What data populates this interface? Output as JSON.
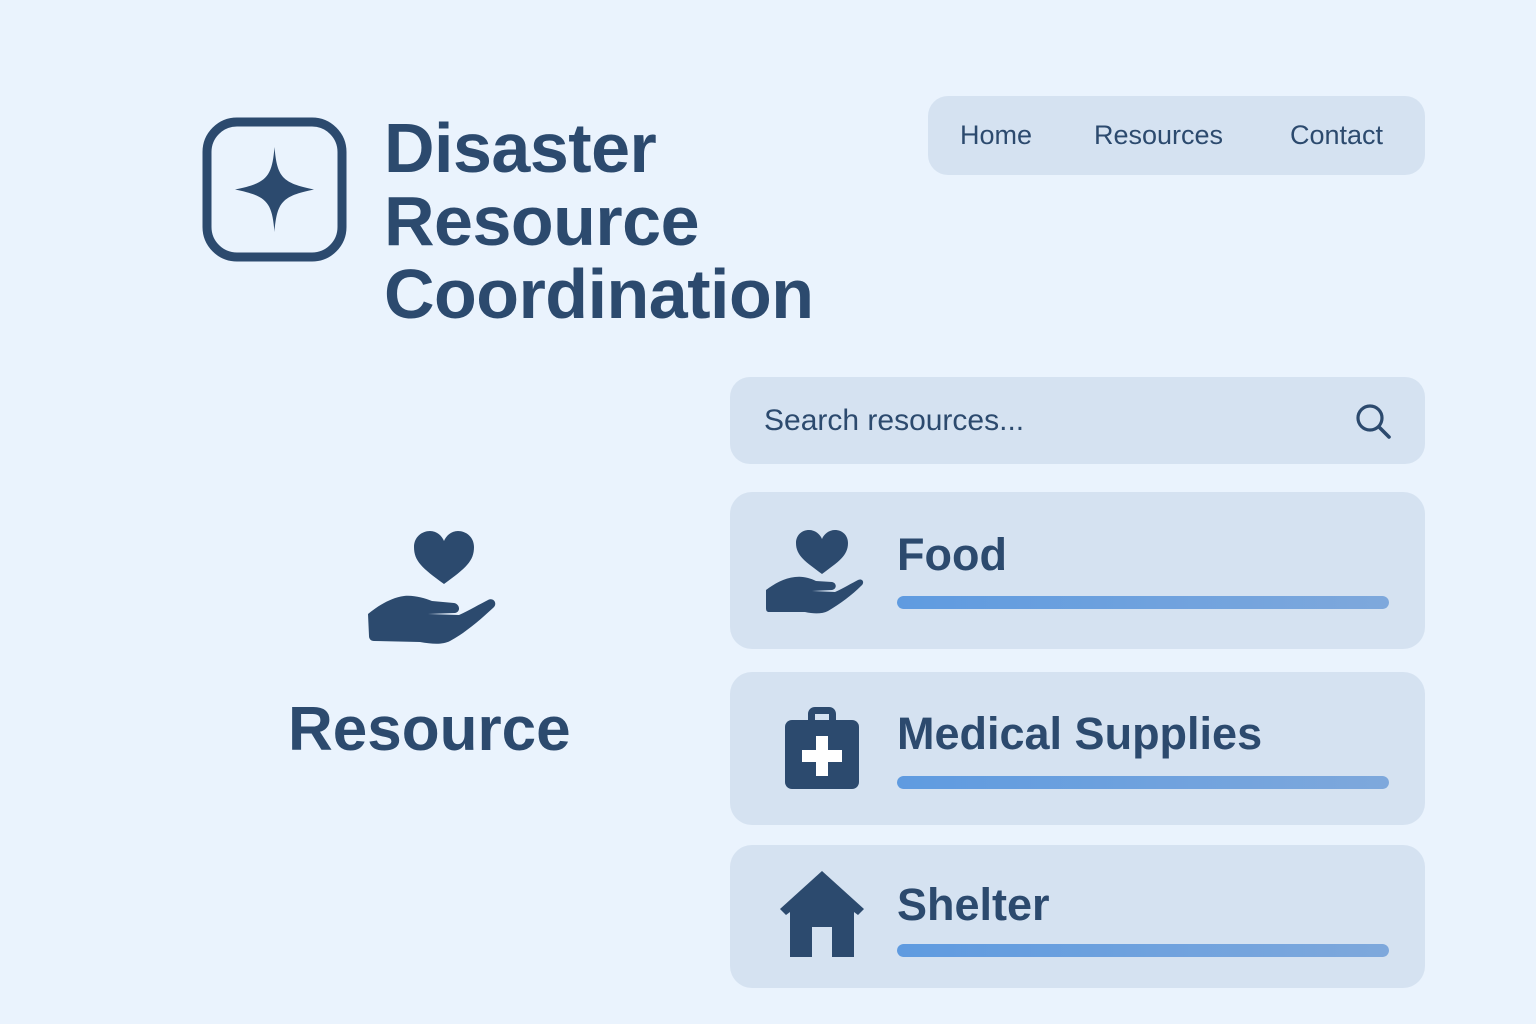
{
  "header": {
    "title_lines": [
      "Disaster",
      "Resource",
      "Coordination"
    ],
    "logo_icon": "sparkle-icon"
  },
  "nav": {
    "items": [
      {
        "label": "Home"
      },
      {
        "label": "Resources"
      },
      {
        "label": "Contact"
      }
    ]
  },
  "search": {
    "placeholder": "Search resources...",
    "icon": "search-icon"
  },
  "sidebar": {
    "icon": "hand-heart-icon",
    "label": "Resource"
  },
  "resources": [
    {
      "label": "Food",
      "icon": "hand-heart-icon",
      "progress": 1.0
    },
    {
      "label": "Medical Supplies",
      "icon": "medical-kit-icon",
      "progress": 1.0
    },
    {
      "label": "Shelter",
      "icon": "house-icon",
      "progress": 1.0
    }
  ],
  "colors": {
    "background": "#eaf3fd",
    "panel": "#d5e2f1",
    "text": "#2c4a6e",
    "accent": "#5f9be0"
  }
}
